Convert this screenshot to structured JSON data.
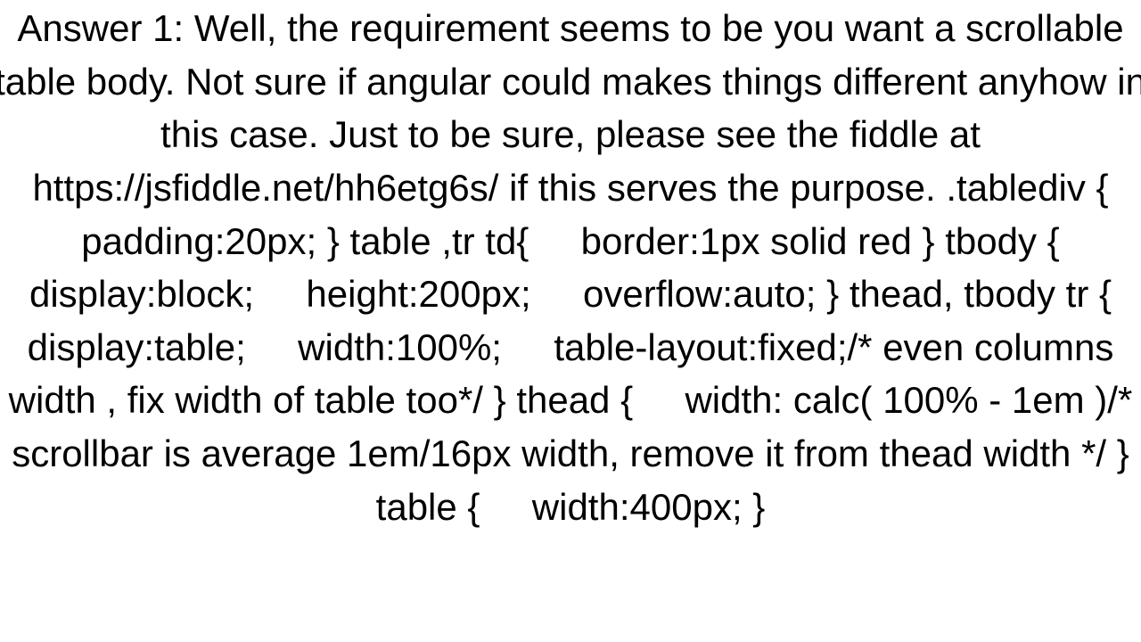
{
  "answer": {
    "label": "Answer 1:",
    "intro": "Well, the requirement seems to be you want a scrollable table body. Not sure if angular could makes things different anyhow in this case. Just to be sure, please see the fiddle at",
    "fiddle_url": "https://jsfiddle.net/hh6etg6s/",
    "intro_tail": "if this serves the purpose.",
    "css_code": ".tablediv {   padding:20px; } table ,tr td{     border:1px solid red } tbody {     display:block;     height:200px;     overflow:auto; } thead, tbody tr {     display:table;     width:100%;     table-layout:fixed;/* even columns width , fix width of table too*/ } thead {     width: calc( 100% - 1em )/* scrollbar is average 1em/16px width, remove it from thead width */ } table {     width:400px; }"
  }
}
